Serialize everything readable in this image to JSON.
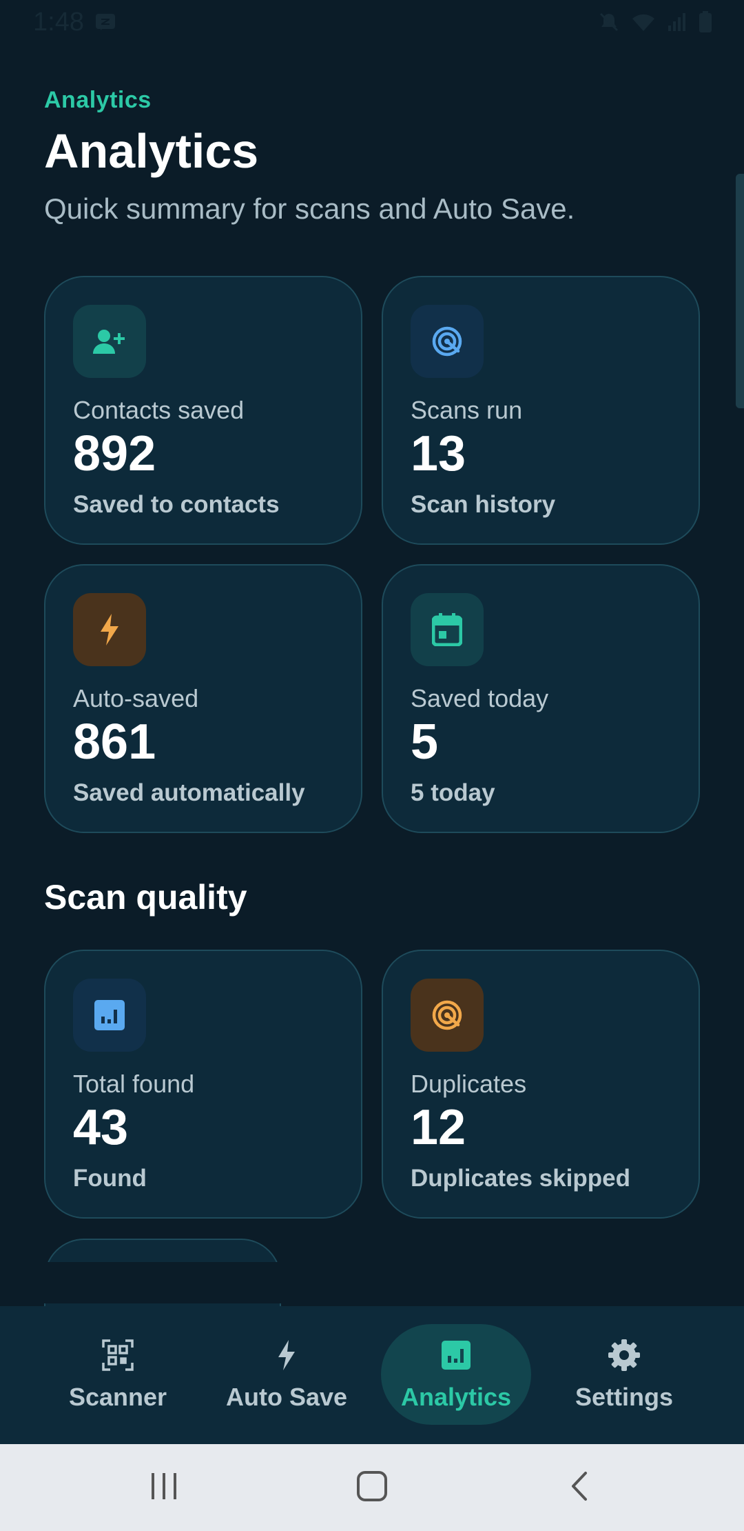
{
  "status_bar": {
    "time": "1:48"
  },
  "header": {
    "overline": "Analytics",
    "title": "Analytics",
    "subtitle": "Quick summary for scans and Auto Save."
  },
  "summary_cards": [
    {
      "label": "Contacts saved",
      "value": "892",
      "caption": "Saved to contacts",
      "icon": "person-add-icon",
      "icon_color": "#2cc9a6",
      "icon_bg": "#12404a"
    },
    {
      "label": "Scans run",
      "value": "13",
      "caption": "Scan history",
      "icon": "radar-icon",
      "icon_color": "#5aa9f0",
      "icon_bg": "#11304a"
    },
    {
      "label": "Auto-saved",
      "value": "861",
      "caption": "Saved automatically",
      "icon": "bolt-icon",
      "icon_color": "#f2a84a",
      "icon_bg": "#4a331c"
    },
    {
      "label": "Saved today",
      "value": "5",
      "caption": "5 today",
      "icon": "calendar-icon",
      "icon_color": "#2cc9a6",
      "icon_bg": "#12404a"
    }
  ],
  "scan_quality": {
    "title": "Scan quality",
    "cards": [
      {
        "label": "Total found",
        "value": "43",
        "caption": "Found",
        "icon": "bar-chart-icon",
        "icon_color": "#5aa9f0",
        "icon_bg": "#11304a"
      },
      {
        "label": "Duplicates",
        "value": "12",
        "caption": "Duplicates skipped",
        "icon": "radar-icon",
        "icon_color": "#f2a84a",
        "icon_bg": "#4a331c"
      }
    ]
  },
  "bottom_nav": {
    "items": [
      {
        "label": "Scanner",
        "icon": "qr-scan-icon"
      },
      {
        "label": "Auto Save",
        "icon": "bolt-icon"
      },
      {
        "label": "Analytics",
        "icon": "bar-chart-icon",
        "active": true
      },
      {
        "label": "Settings",
        "icon": "gear-icon"
      }
    ]
  },
  "colors": {
    "background": "#0b1c28",
    "card": "#0d2a3a",
    "card_border": "#1e4b5b",
    "accent": "#2cc9a6",
    "muted_text": "#b9c9d1"
  }
}
